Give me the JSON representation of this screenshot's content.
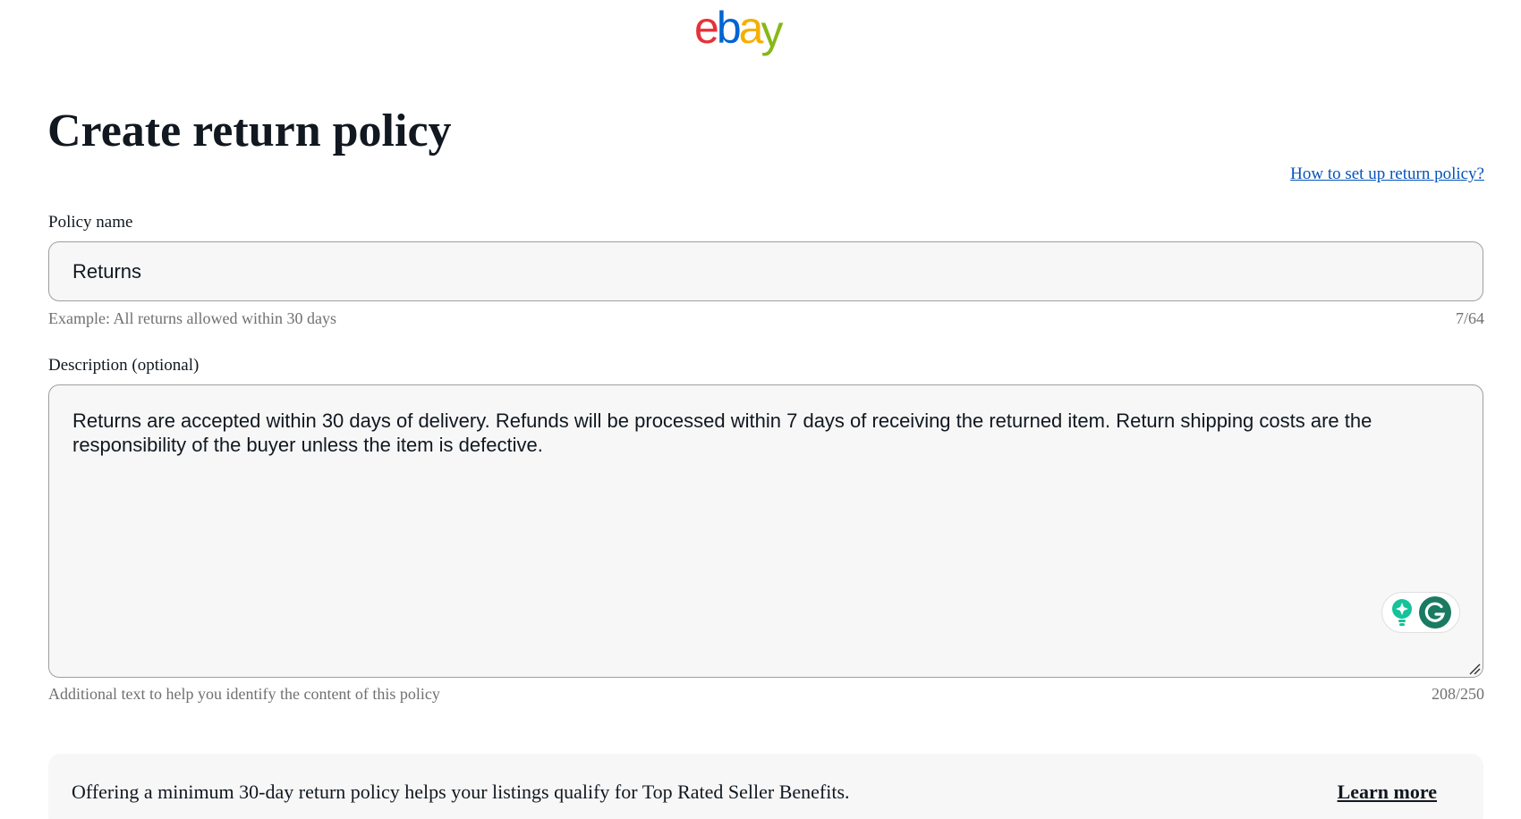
{
  "header": {
    "logo": {
      "e": "e",
      "b": "b",
      "a": "a",
      "y": "y"
    }
  },
  "page": {
    "title": "Create return policy",
    "help_link": "How to set up return policy?"
  },
  "policy_name": {
    "label": "Policy name",
    "value": "Returns",
    "helper": "Example: All returns allowed within 30 days",
    "counter": "7/64"
  },
  "description": {
    "label": "Description (optional)",
    "value": "Returns are accepted within 30 days of delivery. Refunds will be processed within 7 days of receiving the returned item. Return shipping costs are the responsibility of the buyer unless the item is defective.",
    "helper": "Additional text to help you identify the content of this policy",
    "counter": "208/250",
    "assistant_icons": [
      "lightbulb-icon",
      "grammarly-icon"
    ]
  },
  "banner": {
    "text": "Offering a minimum 30-day return policy helps your listings qualify for Top Rated Seller Benefits.",
    "link": "Learn more"
  },
  "colors": {
    "logo_e": "#e53238",
    "logo_b": "#0064d2",
    "logo_a": "#f5af02",
    "logo_y": "#86b817",
    "link": "#0654ba",
    "field_bg": "#f7f7f7",
    "helper_text": "#707070"
  }
}
